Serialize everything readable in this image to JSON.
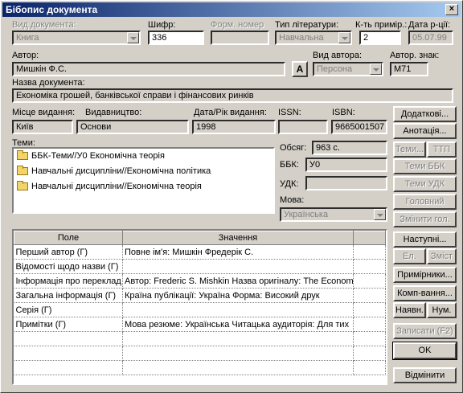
{
  "window": {
    "title": "Бібопис документа",
    "close": "×"
  },
  "labels": {
    "doc_type": "Вид документа:",
    "cipher": "Шифр:",
    "form_number": "Форм. номер",
    "lit_type": "Тип літератури:",
    "copies": "К-ть примір.:",
    "input_date": "Дата р-ції:",
    "author": "Автор:",
    "author_type": "Вид автора:",
    "author_sign": "Автор. знак:",
    "doc_name": "Назва документа:",
    "place": "Місце видання:",
    "publisher": "Видавництво:",
    "date_year": "Дата/Рік видання:",
    "issn": "ISSN:",
    "isbn": "ISBN:",
    "topics": "Теми:",
    "volume": "Обсяг:",
    "bbk": "ББК:",
    "udk": "УДК:",
    "language": "Мова:"
  },
  "fields": {
    "doc_type": "Книга",
    "cipher": "336",
    "form_number": "",
    "lit_type": "Навчальна",
    "copies": "2",
    "input_date": "05.07.99",
    "author": "Мишкін Ф.С.",
    "author_type": "Персона",
    "author_sign": "М71",
    "doc_name": "Економіка грошей, банківської справи і фінансових ринків",
    "place": "Київ",
    "publisher": "Основи",
    "date_year": "1998",
    "issn": "",
    "isbn": "9665001507",
    "volume": "963 с.",
    "bbk": "У0",
    "udk": "",
    "language": "Українська"
  },
  "author_button": "A",
  "topics": [
    "ББК-Теми//У0 Економічна теорія",
    "Навчальні дисципліни//Економічна політика",
    "Навчальні дисципліни//Економічна теорія"
  ],
  "table": {
    "headers": [
      "Поле",
      "Значення"
    ],
    "rows": [
      [
        "Перший автор (Г)",
        "Повне ім'я: Мишкін Фредерік С."
      ],
      [
        "Відомості щодо назви (Г)",
        ""
      ],
      [
        "Інформація про переклад",
        "Автор: Frederic S. Mishkin Назва оригіналу: The Economic"
      ],
      [
        "Загальна інформація (Г)",
        "Країна публікації: Україна Форма: Високий друк"
      ],
      [
        "Серія (Г)",
        ""
      ],
      [
        "Примітки (Г)",
        "Мова резюме: Українська Читацька аудиторія: Для тих"
      ],
      [
        "",
        ""
      ],
      [
        "",
        ""
      ],
      [
        "",
        ""
      ]
    ]
  },
  "buttons": {
    "additional": "Додаткові...",
    "annotation": "Анотація...",
    "topics": "Теми...",
    "ttp": "ТТП",
    "topics_bbk": "Теми ББК",
    "topics_udk": "Теми УДК",
    "main": "Головний",
    "change_main": "Змінити гол.",
    "next": "Наступні...",
    "el": "Ел.",
    "contents": "Зміст",
    "copies_btn": "Примірники...",
    "completing": "Комп-вання...",
    "availability": "Наявн.",
    "num": "Нум.",
    "save": "Записати (F2)",
    "ok": "OK",
    "cancel": "Відмінити"
  }
}
